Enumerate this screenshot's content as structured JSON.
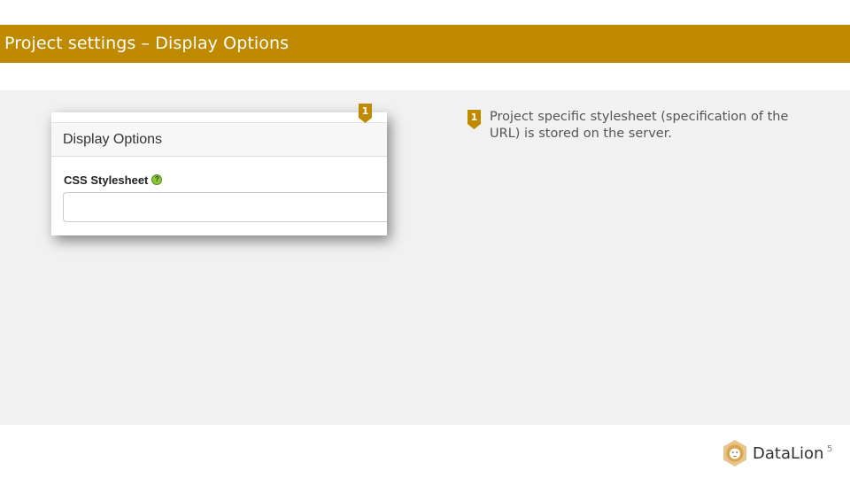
{
  "slide": {
    "title": "Project settings – Display Options",
    "page_number": "5",
    "accent_color": "#c08a00"
  },
  "panel": {
    "title": "Display Options",
    "field_label": "CSS Stylesheet",
    "help_icon": "question-icon",
    "input_value": "",
    "input_placeholder": ""
  },
  "markers": {
    "panel_marker": "1",
    "note_marker": "1"
  },
  "note": {
    "text": "Project specific stylesheet (specification of the URL) is stored on the server."
  },
  "logo": {
    "name": "DataLion",
    "icon": "lion-icon"
  }
}
